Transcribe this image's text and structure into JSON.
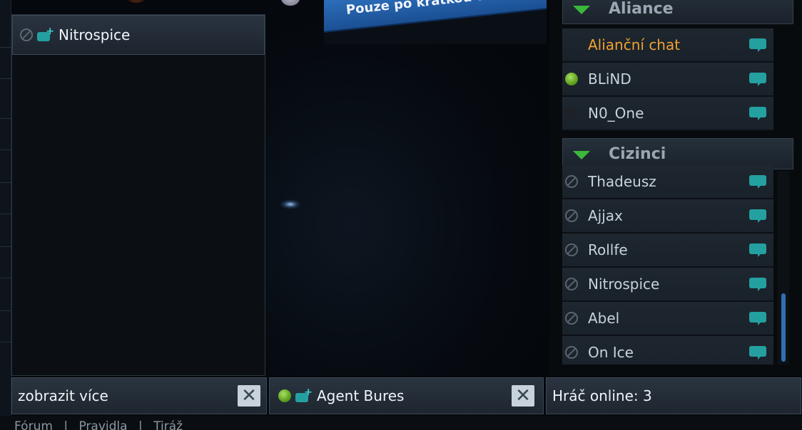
{
  "banner": {
    "text": "Pouze po krátkou do"
  },
  "chat_window": {
    "title": "Nitrospice",
    "footer_text": "zobrazit více"
  },
  "private_chat": {
    "contact": "Agent Bures"
  },
  "online_footer": {
    "text": "Hráč online: 3"
  },
  "bottom_nav": {
    "items": [
      "Fórum",
      "|",
      "Pravidla",
      "|",
      "Tiráž"
    ]
  },
  "alliance": {
    "title": "Aliance",
    "rows": [
      {
        "name": "Alianční chat",
        "status": "none"
      },
      {
        "name": "BLiND",
        "status": "online"
      },
      {
        "name": "N0_One",
        "status": "offline"
      }
    ]
  },
  "strangers": {
    "title": "Cizinci",
    "rows": [
      {
        "name": "Thadeusz",
        "status": "blocked"
      },
      {
        "name": "Ajjax",
        "status": "blocked"
      },
      {
        "name": "Rollfe",
        "status": "blocked"
      },
      {
        "name": "Nitrospice",
        "status": "blocked"
      },
      {
        "name": "Abel",
        "status": "blocked"
      },
      {
        "name": "On Ice",
        "status": "blocked"
      }
    ]
  },
  "colors": {
    "accent": "#24a0a0",
    "online": "#5fa020",
    "highlight": "#f0a030",
    "banner": "#2f73c0"
  }
}
